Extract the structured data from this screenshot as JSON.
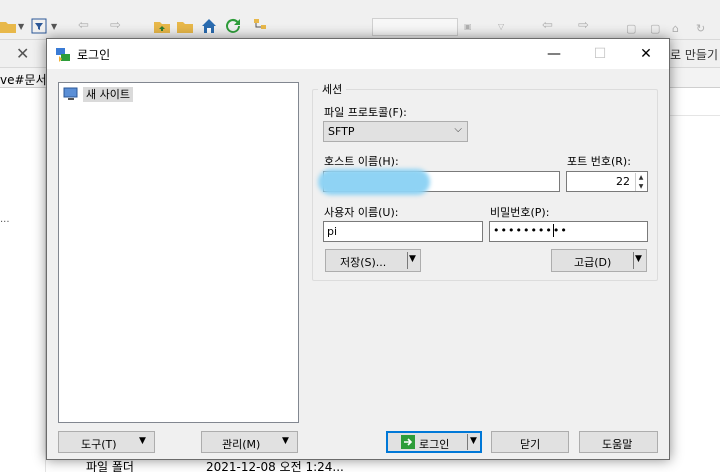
{
  "background": {
    "path_text": "ve#문서",
    "right_toolbar_text": "로 만들기",
    "dots": "...",
    "bottom_row": {
      "type": "파일 폴더",
      "date": "2021-12-08  오전 1:24..."
    }
  },
  "dialog": {
    "title": "로그인",
    "controls": {
      "minimize": "—",
      "maximize": "☐",
      "close": "✕"
    },
    "site_tree": {
      "items": [
        {
          "label": "새 사이트"
        }
      ]
    },
    "session": {
      "group_title": "세션",
      "protocol_label": "파일 프로토콜(F):",
      "protocol_value": "SFTP",
      "host_label": "호스트 이름(H):",
      "host_value": "",
      "port_label": "포트 번호(R):",
      "port_value": "22",
      "user_label": "사용자 이름(U):",
      "user_value": "pi",
      "password_label": "비밀번호(P):",
      "password_value": "••••••••••",
      "save_label": "저장(S)...",
      "advanced_label": "고급(D)"
    },
    "footer": {
      "tools_label": "도구(T)",
      "manage_label": "관리(M)",
      "login_label": "로그인",
      "close_label": "닫기",
      "help_label": "도움말"
    }
  },
  "colors": {
    "accent": "#0078d7",
    "redaction": "#8fd3f4",
    "dialog_bg": "#f0f0f0"
  }
}
